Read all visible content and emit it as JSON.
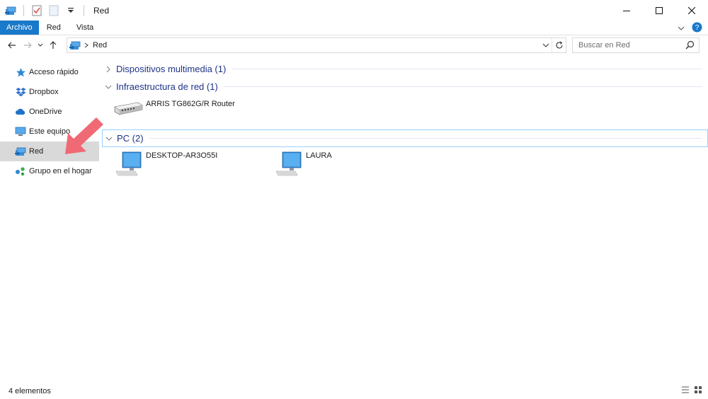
{
  "window": {
    "title": "Red",
    "minimize_glyph": "—",
    "maximize_glyph": "☐",
    "close_glyph": "✕"
  },
  "ribbon": {
    "tabs": [
      {
        "label": "Archivo"
      },
      {
        "label": "Red"
      },
      {
        "label": "Vista"
      }
    ]
  },
  "address": {
    "crumb": "Red",
    "search_placeholder": "Buscar en Red"
  },
  "sidebar": {
    "items": [
      {
        "label": "Acceso rápido",
        "icon": "star-icon"
      },
      {
        "label": "Dropbox",
        "icon": "dropbox-icon"
      },
      {
        "label": "OneDrive",
        "icon": "cloud-icon"
      },
      {
        "label": "Este equipo",
        "icon": "computer-icon"
      },
      {
        "label": "Red",
        "icon": "network-icon",
        "selected": true
      },
      {
        "label": "Grupo en el hogar",
        "icon": "homegroup-icon"
      }
    ]
  },
  "content": {
    "groups": [
      {
        "title": "Dispositivos multimedia (1)",
        "expanded": false,
        "items": []
      },
      {
        "title": "Infraestructura de red (1)",
        "expanded": true,
        "items": [
          {
            "name": "ARRIS TG862G/R Router",
            "icon": "router-icon"
          }
        ]
      },
      {
        "title": "PC (2)",
        "expanded": true,
        "items": [
          {
            "name": "DESKTOP-AR3O55I",
            "icon": "pc-icon"
          },
          {
            "name": "LAURA",
            "icon": "pc-icon"
          }
        ]
      }
    ]
  },
  "status": {
    "count_text": "4 elementos"
  },
  "colors": {
    "accent": "#1979ca",
    "group_title": "#1e3287",
    "annotation_arrow": "#f06a76"
  }
}
